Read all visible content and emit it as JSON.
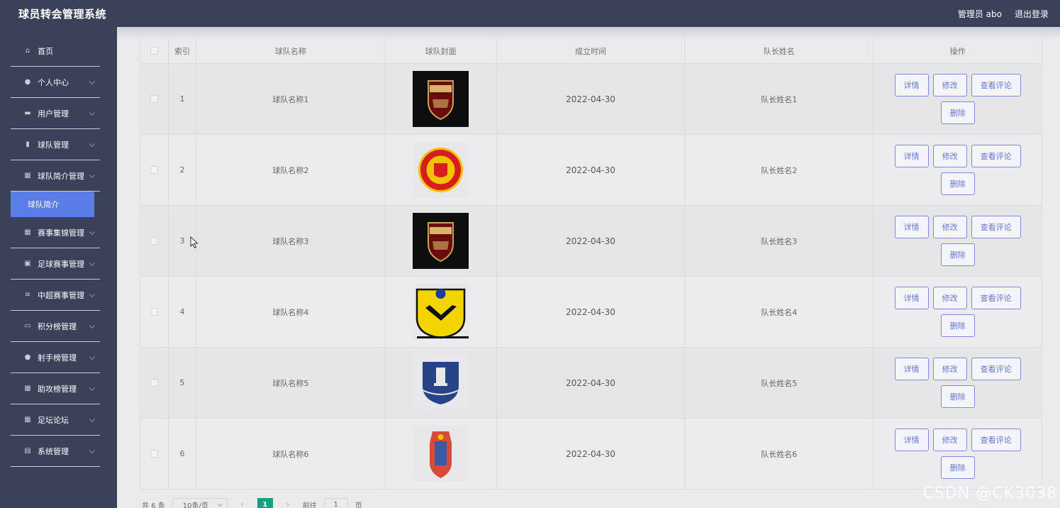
{
  "header": {
    "title": "球员转会管理系统",
    "user": "管理员 abo",
    "logout": "退出登录"
  },
  "sidebar": {
    "items": [
      {
        "label": "首页",
        "icon": "home-icon",
        "glyph": "⌂",
        "chevron": false
      },
      {
        "label": "个人中心",
        "icon": "user-icon",
        "glyph": "●",
        "chevron": true
      },
      {
        "label": "用户管理",
        "icon": "monitor-icon",
        "glyph": "▬",
        "chevron": true
      },
      {
        "label": "球队管理",
        "icon": "bar-chart-icon",
        "glyph": "▮",
        "chevron": true
      },
      {
        "label": "球队简介管理",
        "icon": "grid-icon",
        "glyph": "▦",
        "chevron": true
      },
      {
        "label": "赛事集锦管理",
        "icon": "grid-icon",
        "glyph": "▦",
        "chevron": true
      },
      {
        "label": "足球赛事管理",
        "icon": "form-icon",
        "glyph": "▣",
        "chevron": true
      },
      {
        "label": "中超赛事管理",
        "icon": "sliders-icon",
        "glyph": "≡",
        "chevron": true
      },
      {
        "label": "积分榜管理",
        "icon": "briefcase-icon",
        "glyph": "▭",
        "chevron": true
      },
      {
        "label": "射手榜管理",
        "icon": "user-icon",
        "glyph": "●",
        "chevron": true
      },
      {
        "label": "助攻榜管理",
        "icon": "grid-icon",
        "glyph": "▦",
        "chevron": true
      },
      {
        "label": "足坛论坛",
        "icon": "grid-icon",
        "glyph": "▦",
        "chevron": true
      },
      {
        "label": "系统管理",
        "icon": "clipboard-icon",
        "glyph": "▤",
        "chevron": true
      }
    ],
    "active_sub": "球队简介"
  },
  "table": {
    "headers": [
      "索引",
      "球队名称",
      "球队封面",
      "成立时间",
      "队长姓名",
      "操作"
    ],
    "rows": [
      {
        "index": "1",
        "name": "球队名称1",
        "cover": "arsenal-crest",
        "date": "2022-04-30",
        "captain": "队长姓名1"
      },
      {
        "index": "2",
        "name": "球队名称2",
        "cover": "manchester-united-crest",
        "date": "2022-04-30",
        "captain": "队长姓名2"
      },
      {
        "index": "3",
        "name": "球队名称3",
        "cover": "arsenal-crest",
        "date": "2022-04-30",
        "captain": "队长姓名3"
      },
      {
        "index": "4",
        "name": "球队名称4",
        "cover": "yellow-shield-crest",
        "date": "2022-04-30",
        "captain": "队长姓名4"
      },
      {
        "index": "5",
        "name": "球队名称5",
        "cover": "everton-crest",
        "date": "2022-04-30",
        "captain": "队长姓名5"
      },
      {
        "index": "6",
        "name": "球队名称6",
        "cover": "red-blue-crest",
        "date": "2022-04-30",
        "captain": "队长姓名6"
      }
    ],
    "actions": {
      "detail": "详情",
      "edit": "修改",
      "comments": "查看评论",
      "delete": "删除"
    }
  },
  "pager": {
    "total": "共 6 条",
    "page_size": "10条/页",
    "prev": "‹",
    "current": "1",
    "next": "›",
    "goto_label": "前往",
    "goto_value": "1",
    "page_unit": "页"
  },
  "watermark": "CSDN @CK3038",
  "colors": {
    "sidebar_bg": "#3a4159",
    "active_sub": "#5b7de8",
    "button_border": "#7e8bd6",
    "pager_active": "#12a082"
  }
}
